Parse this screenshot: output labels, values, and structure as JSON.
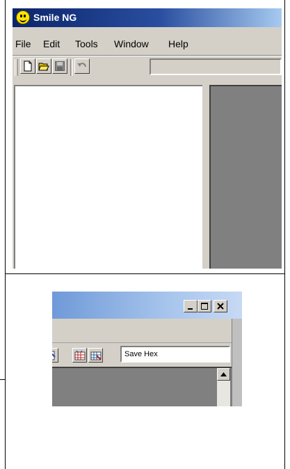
{
  "app": {
    "title": "Smile NG",
    "icon": "smiley-icon"
  },
  "menu": {
    "items": [
      "File",
      "Edit",
      "Tools",
      "Window",
      "Help"
    ]
  },
  "toolbar": {
    "buttons": [
      "new-file-icon",
      "open-folder-icon",
      "save-disk-icon",
      "undo-icon"
    ]
  },
  "detail": {
    "window_buttons": [
      "minimize-icon",
      "maximize-icon",
      "close-icon"
    ],
    "toolbar_icons": [
      "toolbar-partial-icon",
      "hex-grid-icon",
      "hex-edit-icon"
    ],
    "save_hex_value": "Save Hex",
    "scroll_icon": "scroll-up-arrow-icon"
  }
}
